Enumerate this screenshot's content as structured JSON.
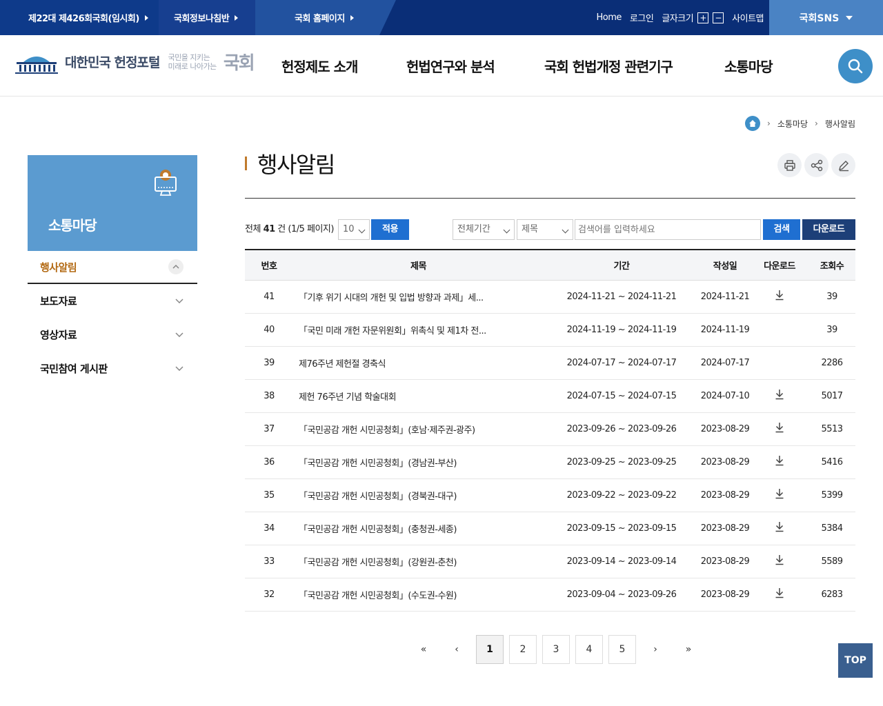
{
  "topbar": {
    "tabs": [
      "제22대 제426회국회(임시회)",
      "국회정보나침반",
      "국회 홈페이지"
    ],
    "home": "Home",
    "login": "로그인",
    "font_size": "글자크기",
    "font_plus": "+",
    "font_minus": "−",
    "sitemap": "사이트맵",
    "sns": "국회SNS"
  },
  "header": {
    "logo_text": "대한민국 헌정포털",
    "slogan_line1": "국민을 지키는",
    "slogan_line2": "미래로 나아가는",
    "slogan_big": "국회",
    "gnb": [
      "헌정제도 소개",
      "헌법연구와 분석",
      "국회 헌법개정 관련기구",
      "소통마당"
    ]
  },
  "breadcrumb": [
    "소통마당",
    "행사알림"
  ],
  "sidebar": {
    "title": "소통마당",
    "items": [
      {
        "label": "행사알림",
        "active": true
      },
      {
        "label": "보도자료",
        "active": false
      },
      {
        "label": "영상자료",
        "active": false
      },
      {
        "label": "국민참여 게시판",
        "active": false
      }
    ]
  },
  "content": {
    "title": "행사알림",
    "total_prefix": "전체",
    "total_count": "41",
    "total_suffix": "건 (1/5 페이지)",
    "per_page": "10",
    "apply": "적용",
    "period": "전체기간",
    "field": "제목",
    "search_placeholder": "검색어를 입력하세요",
    "search_btn": "검색",
    "download_btn": "다운로드"
  },
  "table": {
    "headers": [
      "번호",
      "제목",
      "기간",
      "작성일",
      "다운로드",
      "조회수"
    ],
    "rows": [
      {
        "no": "41",
        "title": "「기후 위기 시대의 개헌 및 입법 방향과 과제」세...",
        "period": "2024-11-21 ~ 2024-11-21",
        "date": "2024-11-21",
        "download": true,
        "views": "39"
      },
      {
        "no": "40",
        "title": "「국민 미래 개헌 자문위원회」위촉식 및 제1차 전...",
        "period": "2024-11-19 ~ 2024-11-19",
        "date": "2024-11-19",
        "download": false,
        "views": "39"
      },
      {
        "no": "39",
        "title": "제76주년 제헌절 경축식",
        "period": "2024-07-17 ~ 2024-07-17",
        "date": "2024-07-17",
        "download": false,
        "views": "2286"
      },
      {
        "no": "38",
        "title": "제헌 76주년 기념 학술대회",
        "period": "2024-07-15 ~ 2024-07-15",
        "date": "2024-07-10",
        "download": true,
        "views": "5017"
      },
      {
        "no": "37",
        "title": "「국민공감 개헌 시민공청회」(호남·제주권-광주)",
        "period": "2023-09-26 ~ 2023-09-26",
        "date": "2023-08-29",
        "download": true,
        "views": "5513"
      },
      {
        "no": "36",
        "title": "「국민공감 개헌 시민공청회」(경남권-부산)",
        "period": "2023-09-25 ~ 2023-09-25",
        "date": "2023-08-29",
        "download": true,
        "views": "5416"
      },
      {
        "no": "35",
        "title": "「국민공감 개헌 시민공청회」(경북권-대구)",
        "period": "2023-09-22 ~ 2023-09-22",
        "date": "2023-08-29",
        "download": true,
        "views": "5399"
      },
      {
        "no": "34",
        "title": "「국민공감 개헌 시민공청회」(충청권-세종)",
        "period": "2023-09-15 ~ 2023-09-15",
        "date": "2023-08-29",
        "download": true,
        "views": "5384"
      },
      {
        "no": "33",
        "title": "「국민공감 개헌 시민공청회」(강원권-춘천)",
        "period": "2023-09-14 ~ 2023-09-14",
        "date": "2023-08-29",
        "download": true,
        "views": "5589"
      },
      {
        "no": "32",
        "title": "「국민공감 개헌 시민공청회」(수도권-수원)",
        "period": "2023-09-04 ~ 2023-09-26",
        "date": "2023-08-29",
        "download": true,
        "views": "6283"
      }
    ]
  },
  "pagination": {
    "first": "«",
    "prev": "‹",
    "pages": [
      "1",
      "2",
      "3",
      "4",
      "5"
    ],
    "current": "1",
    "next": "›",
    "last": "»"
  },
  "top_button": "TOP",
  "colors": {
    "topbar": "#0a2e77",
    "accent_blue": "#3e8fc8",
    "sidebar_head": "#5b9bd0",
    "active_menu": "#b36a14",
    "navy_button": "#1d3f78"
  }
}
